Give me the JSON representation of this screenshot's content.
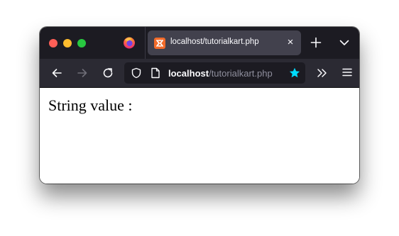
{
  "browser": {
    "tab": {
      "title": "localhost/tutorialkart.php",
      "favicon": "xampp-icon",
      "close_symbol": "×"
    },
    "address_bar": {
      "host": "localhost",
      "path": "/tutorialkart.php"
    },
    "colors": {
      "titlebar": "#1c1b22",
      "toolbar": "#2b2a33",
      "tab_active": "#42414d",
      "star_accent": "#00ddff",
      "favicon": "#f26b2a"
    }
  },
  "page": {
    "text": "String value :"
  }
}
